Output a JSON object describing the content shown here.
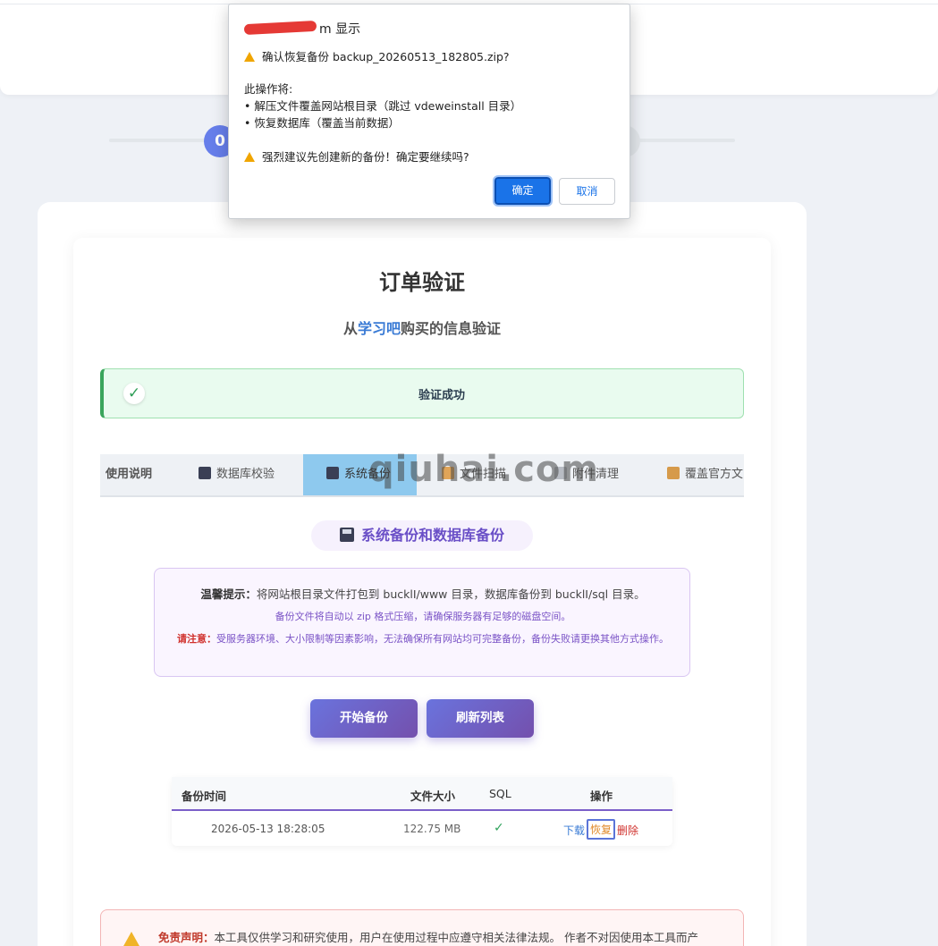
{
  "dialog": {
    "origin_suffix": "m 显示",
    "question": "确认恢复备份 backup_20260513_182805.zip?",
    "intro": "此操作将:",
    "bullet1": "• 解压文件覆盖网站根目录（跳过 vdeweinstall 目录）",
    "bullet2": "• 恢复数据库（覆盖当前数据）",
    "warning": "强烈建议先创建新的备份！确定要继续吗?",
    "ok_label": "确定",
    "cancel_label": "取消"
  },
  "steps": {
    "current": "0"
  },
  "page": {
    "title": "订单验证",
    "subtitle_pre": "从",
    "subtitle_highlight": "学习吧",
    "subtitle_post": "购买的信息验证"
  },
  "success": {
    "icon": "✓",
    "text": "验证成功"
  },
  "tabs": [
    {
      "label": "使用说明"
    },
    {
      "label": "数据库校验"
    },
    {
      "label": "系统备份"
    },
    {
      "label": "文件扫描"
    },
    {
      "label": "附件清理"
    },
    {
      "label": "覆盖官方文"
    }
  ],
  "section": {
    "title": "系统备份和数据库备份"
  },
  "notice": {
    "tip_label": "温馨提示：",
    "tip_text": "将网站根目录文件打包到 bucklI/www 目录，数据库备份到 bucklI/sql 目录。",
    "line2": "备份文件将自动以 zip 格式压缩，请确保服务器有足够的磁盘空间。",
    "attention_label": "请注意：",
    "attention_text": "受服务器环境、大小限制等因素影响，无法确保所有网站均可完整备份，备份失败请更换其他方式操作。"
  },
  "buttons": {
    "start_backup": "开始备份",
    "refresh_list": "刷新列表"
  },
  "table": {
    "headers": [
      "备份时间",
      "文件大小",
      "SQL",
      "操作"
    ],
    "rows": [
      {
        "time": "2026-05-13 18:28:05",
        "size": "122.75 MB",
        "sql": "✓",
        "download": "下载",
        "restore": "恢复",
        "delete": "删除"
      }
    ]
  },
  "disclaimer": {
    "label": "免责声明：",
    "text": "本工具仅供学习和研究使用，用户在使用过程中应遵守相关法律法规。 作者不对因使用本工具而产"
  },
  "watermark": "qiuhai.com",
  "colors": {
    "accent": "#667eea",
    "brand_purple": "#7450ad",
    "success_green": "#3aa55c",
    "dialog_blue": "#1a73e8"
  }
}
